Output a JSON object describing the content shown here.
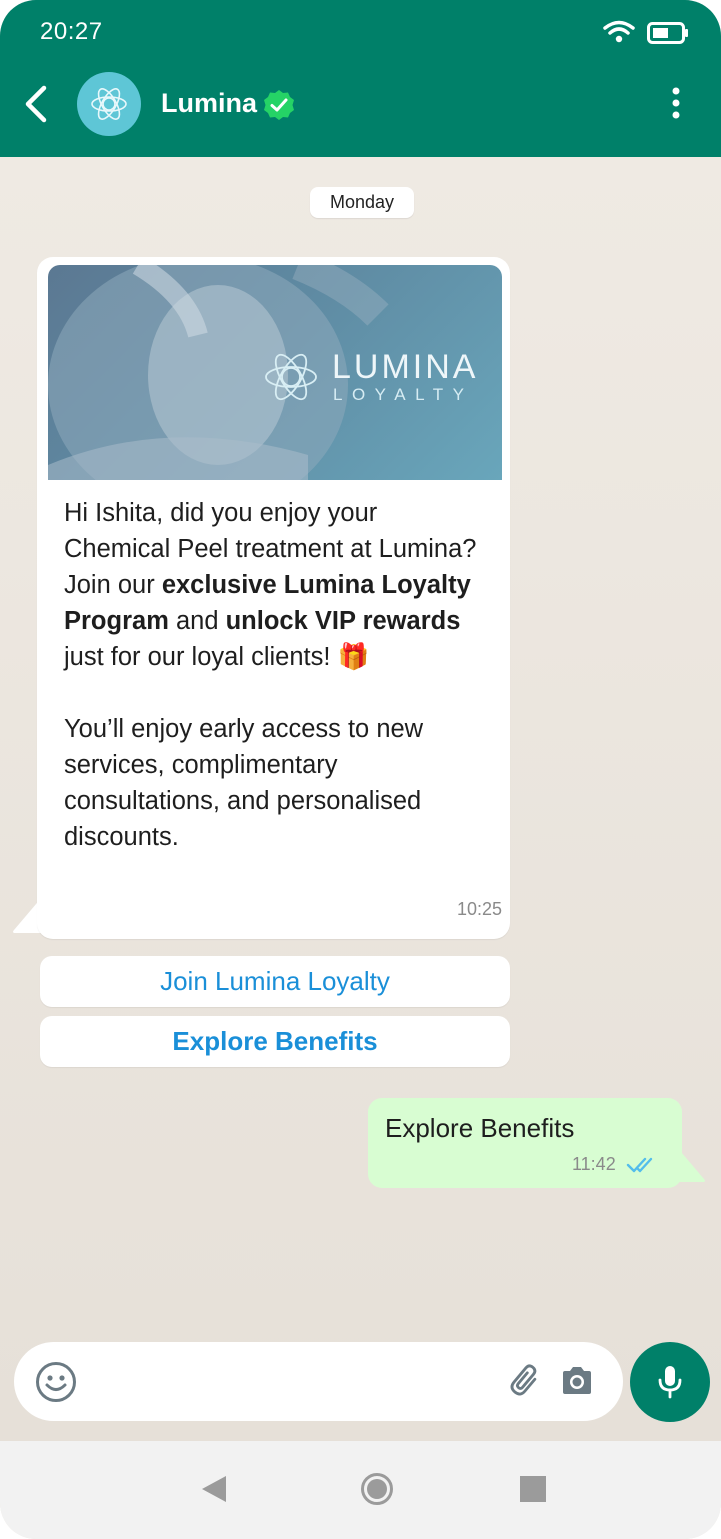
{
  "status_bar": {
    "time": "20:27"
  },
  "header": {
    "contact_name": "Lumina"
  },
  "chat": {
    "day_label": "Monday",
    "incoming": {
      "image_brand_line1": "LUMINA",
      "image_brand_line2": "LOYALTY",
      "text_parts": [
        "Hi Ishita, did you enjoy your Chemical Peel treatment at Lumina? Join our ",
        "exclusive Lumina Loyalty Program",
        " and ",
        "unlock VIP rewards",
        " just for our loyal clients! 🎁\n\nYou’ll enjoy early access to new services, complimentary consultations, and personalised discounts."
      ],
      "time": "10:25"
    },
    "quick_replies": [
      "Join Lumina Loyalty",
      "Explore Benefits"
    ],
    "outgoing": {
      "text": "Explore Benefits",
      "time": "11:42"
    }
  },
  "colors": {
    "header_bg": "#008069",
    "link": "#1a8fd8",
    "outgoing_bubble": "#d8fdd2",
    "read_ticks": "#53bdeb"
  }
}
